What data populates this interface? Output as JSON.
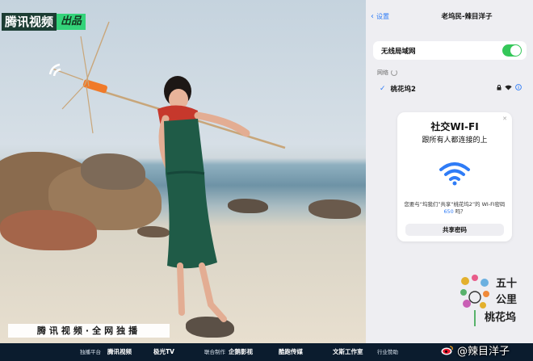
{
  "photo": {
    "brand_name": "腾讯视频",
    "brand_tag": "出品",
    "caption": "腾讯视频·全网独播"
  },
  "settings": {
    "back_label": "设置",
    "title": "老坞民-辣目洋子",
    "wifi_label": "无线局域网",
    "wifi_on": true,
    "networks_header": "网络",
    "connected_network": "桃花坞2"
  },
  "share_card": {
    "title": "社交WI-FI",
    "subtitle": "跟所有人都连接的上",
    "message_pre": "您要与“坞我们”共享“桃花坞2”的 WI-FI密码",
    "message_count": "650",
    "message_post": "吗？",
    "button": "共享密码"
  },
  "show_logo": {
    "line1": "五十",
    "line2": "公里",
    "line3": "桃花坞"
  },
  "bottom_strip": {
    "platform_label": "独播平台",
    "platform_1": "腾讯视频",
    "platform_2": "极光TV",
    "co_label": "联合制作",
    "co_1": "企鹅影视",
    "co_2": "酷跑传媒",
    "studio": "文斯工作室",
    "support_label": "行业赞助"
  },
  "weibo": {
    "handle": "@辣目洋子"
  },
  "colors": {
    "accent_blue": "#2f7cf6",
    "toggle_green": "#34c759",
    "brand_green": "#34d37a"
  }
}
